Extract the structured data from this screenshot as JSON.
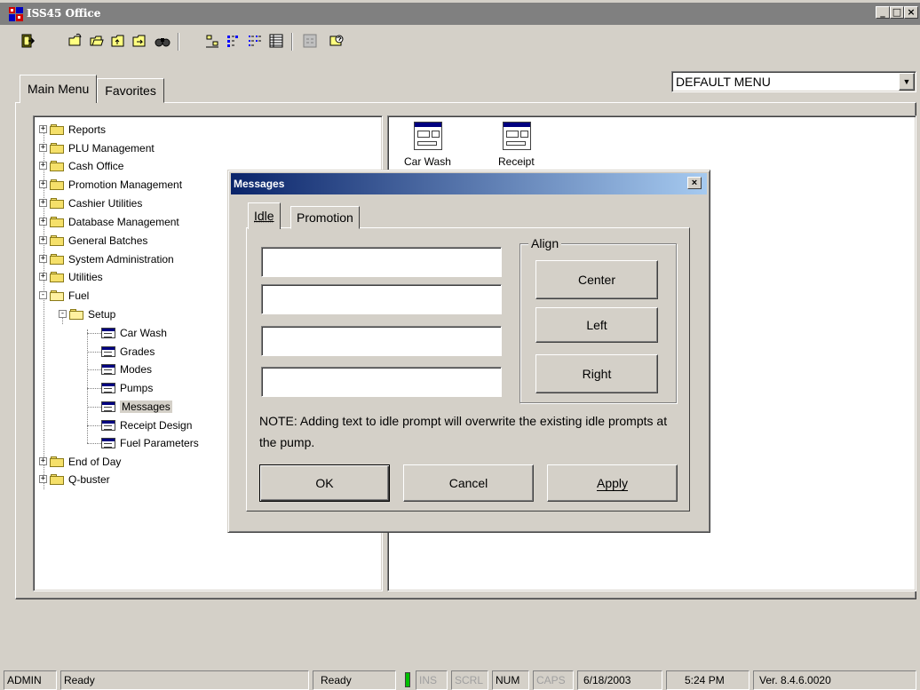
{
  "window": {
    "title": "ISS45 Office",
    "minimize": "_",
    "maximize": "□",
    "close": "×"
  },
  "toolbar": {
    "icons": [
      "exit-icon",
      "open-icon",
      "open-folder-icon",
      "go-up-icon",
      "back-icon",
      "find-icon",
      "large-icons-view-icon",
      "small-icons-view-icon",
      "list-view-icon",
      "details-view-icon",
      "grid-icon",
      "help-icon"
    ]
  },
  "tabs": {
    "main": "Main Menu",
    "favorites": "Favorites"
  },
  "menu_select": {
    "value": "DEFAULT MENU"
  },
  "tree": {
    "items": [
      {
        "label": "Reports",
        "state": "+"
      },
      {
        "label": "PLU Management",
        "state": "+"
      },
      {
        "label": "Cash Office",
        "state": "+"
      },
      {
        "label": "Promotion Management",
        "state": "+"
      },
      {
        "label": "Cashier Utilities",
        "state": "+"
      },
      {
        "label": "Database Management",
        "state": "+"
      },
      {
        "label": "General Batches",
        "state": "+"
      },
      {
        "label": "System Administration",
        "state": "+"
      },
      {
        "label": "Utilities",
        "state": "+"
      },
      {
        "label": "Fuel",
        "state": "-"
      }
    ],
    "setup": {
      "label": "Setup",
      "state": "-"
    },
    "setup_children": [
      "Car Wash",
      "Grades",
      "Modes",
      "Pumps",
      "Messages",
      "Receipt Design",
      "Fuel Parameters"
    ],
    "selected": "Messages",
    "after": [
      {
        "label": "End of Day",
        "state": "+"
      },
      {
        "label": "Q-buster",
        "state": "+"
      }
    ]
  },
  "icon_pane": {
    "icons": [
      {
        "label": "Car Wash"
      },
      {
        "label": "Receipt"
      }
    ]
  },
  "dialog": {
    "title": "Messages",
    "close": "×",
    "tabs": [
      {
        "label": "Idle",
        "accesskey": "I"
      },
      {
        "label": "Promotion",
        "accesskey": "P"
      }
    ],
    "inputs": [
      "",
      "",
      "",
      ""
    ],
    "align_label": "Align",
    "align_buttons": {
      "center": "Center",
      "left": "Left",
      "right": "Right"
    },
    "note": "NOTE: Adding text to idle prompt will overwrite the existing idle prompts at the pump.",
    "buttons": {
      "ok": "OK",
      "cancel": "Cancel",
      "apply": "Apply"
    }
  },
  "statusbar": {
    "user": "ADMIN",
    "status": "Ready",
    "status2": "Ready",
    "ins": "INS",
    "scrl": "SCRL",
    "num": "NUM",
    "caps": "CAPS",
    "date": "6/18/2003",
    "time": "5:24 PM",
    "version": "Ver. 8.4.6.0020"
  }
}
